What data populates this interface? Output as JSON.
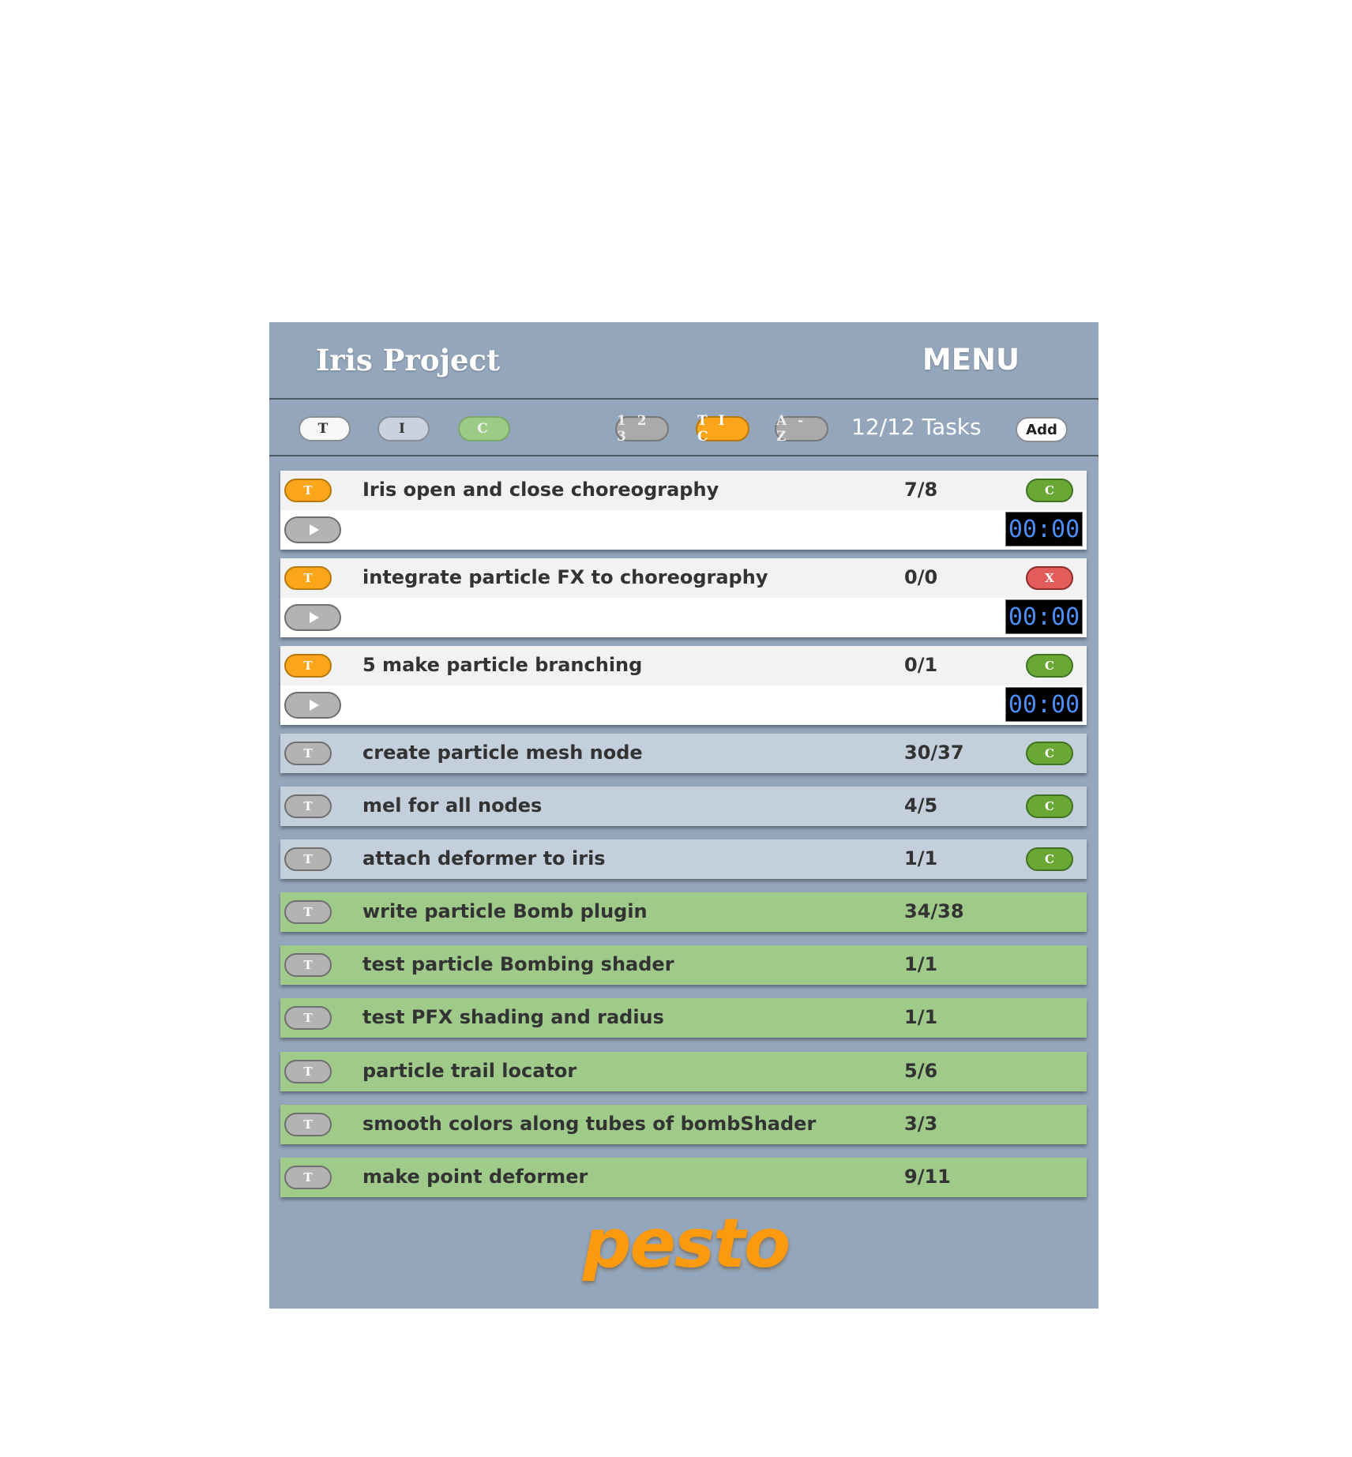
{
  "header": {
    "title": "Iris Project",
    "menu_label": "MENU"
  },
  "toolbar": {
    "filter_buttons": [
      {
        "label": "T"
      },
      {
        "label": "I"
      },
      {
        "label": "C"
      }
    ],
    "sort_buttons": [
      {
        "label": "1 2 3"
      },
      {
        "label": "T I C"
      },
      {
        "label": "A - Z"
      }
    ],
    "task_count": "12/12 Tasks",
    "add_label": "Add"
  },
  "tasks": [
    {
      "type_label": "T",
      "name": "Iris open and close choreography",
      "count": "7/8",
      "status_label": "C",
      "status": "complete",
      "timer": "00:00",
      "expanded": true
    },
    {
      "type_label": "T",
      "name": "integrate particle FX to choreography",
      "count": "0/0",
      "status_label": "X",
      "status": "cancel",
      "timer": "00:00",
      "expanded": true
    },
    {
      "type_label": "T",
      "name": "5 make particle branching",
      "count": "0/1",
      "status_label": "C",
      "status": "complete",
      "timer": "00:00",
      "expanded": true
    },
    {
      "type_label": "T",
      "name": "create particle mesh node",
      "count": "30/37",
      "status_label": "C",
      "status": "complete"
    },
    {
      "type_label": "T",
      "name": "mel for all nodes",
      "count": "4/5",
      "status_label": "C",
      "status": "complete"
    },
    {
      "type_label": "T",
      "name": "attach deformer to iris",
      "count": "1/1",
      "status_label": "C",
      "status": "complete"
    },
    {
      "type_label": "T",
      "name": "write particle Bomb plugin",
      "count": "34/38"
    },
    {
      "type_label": "T",
      "name": "test particle Bombing shader",
      "count": "1/1"
    },
    {
      "type_label": "T",
      "name": "test PFX shading and radius",
      "count": "1/1"
    },
    {
      "type_label": "T",
      "name": "particle trail locator",
      "count": "5/6"
    },
    {
      "type_label": "T",
      "name": "smooth colors along tubes of bombShader",
      "count": "3/3"
    },
    {
      "type_label": "T",
      "name": "make point deformer",
      "count": "9/11"
    }
  ],
  "footer": {
    "logo_text": "pesto"
  },
  "colors": {
    "panel_bg": "#94a6bb",
    "accent_orange": "#fba51b",
    "status_green": "#6aa836",
    "status_red": "#e35c5c",
    "row_blue": "#c4cfdc",
    "row_green": "#9fca8a",
    "timer_digits": "#4d8cf5"
  }
}
